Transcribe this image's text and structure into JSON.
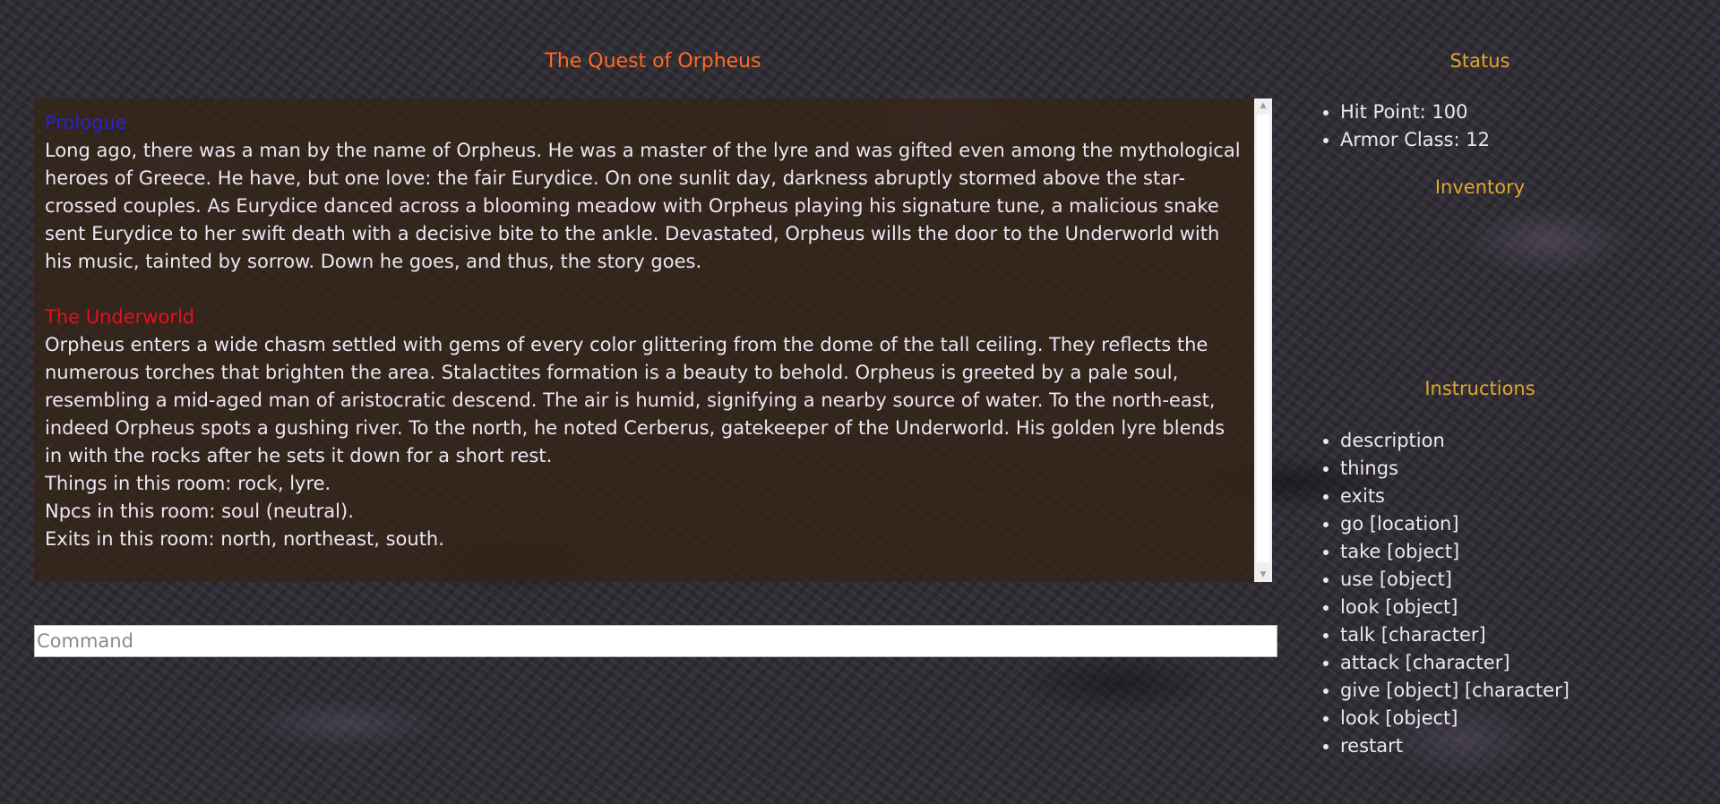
{
  "game": {
    "title": "The Quest of Orpheus"
  },
  "story": {
    "prologue_heading": "Prologue",
    "prologue_text": "Long ago, there was a man by the name of Orpheus. He was a master of the lyre and was gifted even among the mythological heroes of Greece. He have, but one love: the fair Eurydice. On one sunlit day, darkness abruptly stormed above the star-crossed couples. As Eurydice danced across a blooming meadow with Orpheus playing his signature tune, a malicious snake sent Eurydice to her swift death with a decisive bite to the ankle. Devastated, Orpheus wills the door to the Underworld with his music, tainted by sorrow. Down he goes, and thus, the story goes.",
    "room_heading": "The Underworld",
    "room_text": "Orpheus enters a wide chasm settled with gems of every color glittering from the dome of the tall ceiling. They reflects the numerous torches that brighten the area. Stalactites formation is a beauty to behold. Orpheus is greeted by a pale soul, resembling a mid-aged man of aristocratic descend. The air is humid, signifying a nearby source of water. To the north-east, indeed Orpheus spots a gushing river. To the north, he noted Cerberus, gatekeeper of the Underworld. His golden lyre blends in with the rocks after he sets it down for a short rest.",
    "things_line": "Things in this room: rock, lyre.",
    "npcs_line": "Npcs in this room: soul (neutral).",
    "exits_line": "Exits in this room: north, northeast, south."
  },
  "command": {
    "placeholder": "Command",
    "value": ""
  },
  "status": {
    "heading": "Status",
    "items": [
      "Hit Point: 100",
      "Armor Class: 12"
    ]
  },
  "inventory": {
    "heading": "Inventory",
    "items": []
  },
  "instructions": {
    "heading": "Instructions",
    "items": [
      "description",
      "things",
      "exits",
      "go [location]",
      "take [object]",
      "use [object]",
      "look [object]",
      "talk [character]",
      "attack [character]",
      "give [object] [character]",
      "look [object]",
      "restart"
    ]
  },
  "colors": {
    "title": "#ff6a1f",
    "prologue_heading": "#2a1fd6",
    "room_heading": "#e6101a",
    "sidebar_heading": "#e0a630",
    "text": "#ece6f2"
  }
}
